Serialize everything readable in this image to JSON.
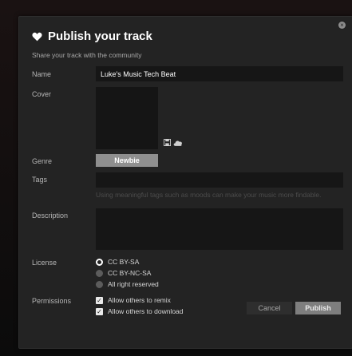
{
  "dialog": {
    "title": "Publish your track",
    "subtitle": "Share your track with the community",
    "close_icon": "close-icon"
  },
  "form": {
    "name_label": "Name",
    "name_value": "Luke's Music Tech Beat",
    "cover_label": "Cover",
    "genre_label": "Genre",
    "genre_value": "Newbie",
    "tags_label": "Tags",
    "tags_value": "",
    "tags_hint": "Using meaningful tags such as moods can make your music more findable.",
    "description_label": "Description",
    "description_value": "",
    "license_label": "License",
    "license_options": [
      {
        "label": "CC BY-SA",
        "selected": true
      },
      {
        "label": "CC BY-NC-SA",
        "selected": false
      },
      {
        "label": "All right reserved",
        "selected": false
      }
    ],
    "permissions_label": "Permissions",
    "permissions": [
      {
        "label": "Allow others to remix",
        "checked": true
      },
      {
        "label": "Allow others to download",
        "checked": true
      }
    ]
  },
  "actions": {
    "cancel_label": "Cancel",
    "publish_label": "Publish"
  }
}
